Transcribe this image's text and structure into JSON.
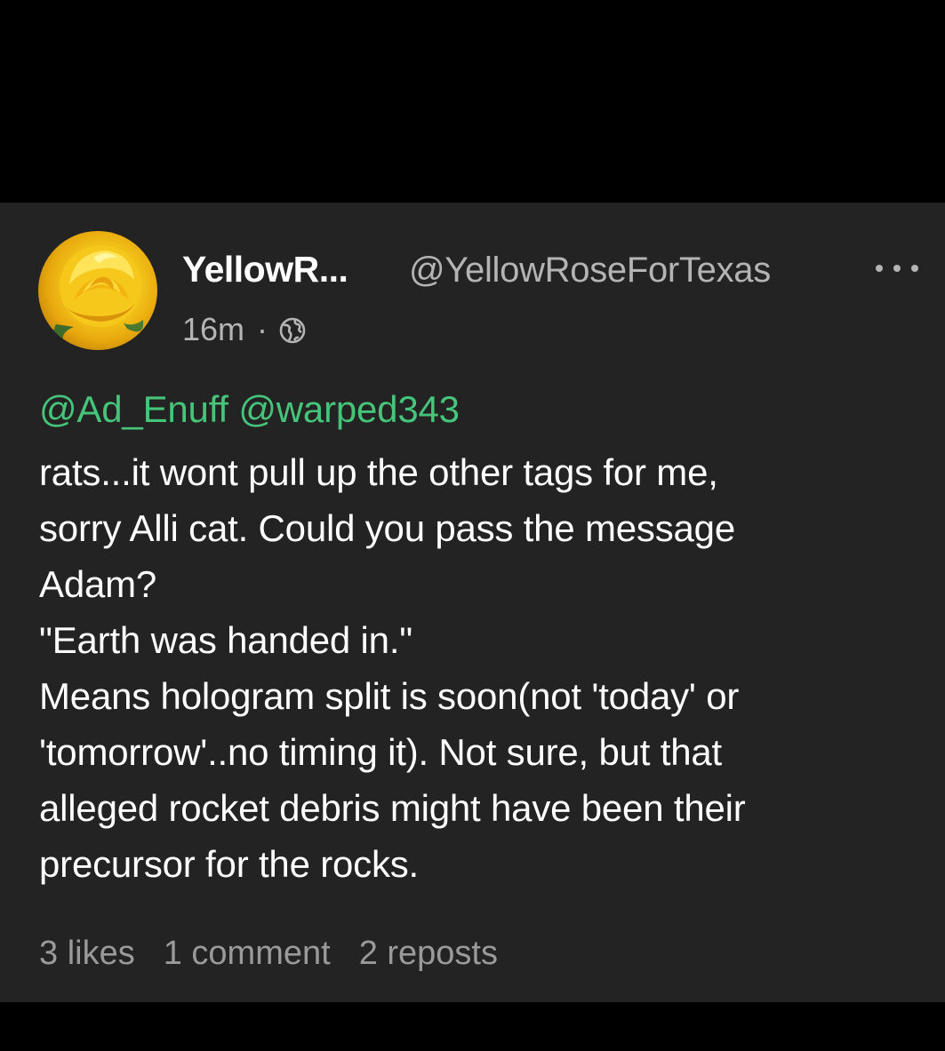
{
  "post": {
    "display_name": "YellowR...",
    "handle": "@YellowRoseForTexas",
    "time": "16m",
    "separator": "·",
    "mentions": "@Ad_Enuff @warped343",
    "body_lines": [
      "rats...it wont pull up the other tags for me,",
      "sorry Alli cat. Could you pass the message",
      "Adam?",
      "\"Earth was handed in.\"",
      "Means hologram split is soon(not 'today' or",
      "'tomorrow'..no timing it). Not sure, but that",
      "alleged rocket debris might have been their",
      "precursor for the rocks."
    ],
    "stats": {
      "likes": "3 likes",
      "comments": "1 comment",
      "reposts": "2 reposts"
    },
    "icons": {
      "avatar": "yellow-rose-avatar",
      "more": "more-horizontal-icon",
      "visibility": "globe-icon"
    }
  },
  "colors": {
    "background": "#000000",
    "card": "#232323",
    "text": "#ffffff",
    "muted": "#b4b4b4",
    "mention": "#45c47a"
  }
}
